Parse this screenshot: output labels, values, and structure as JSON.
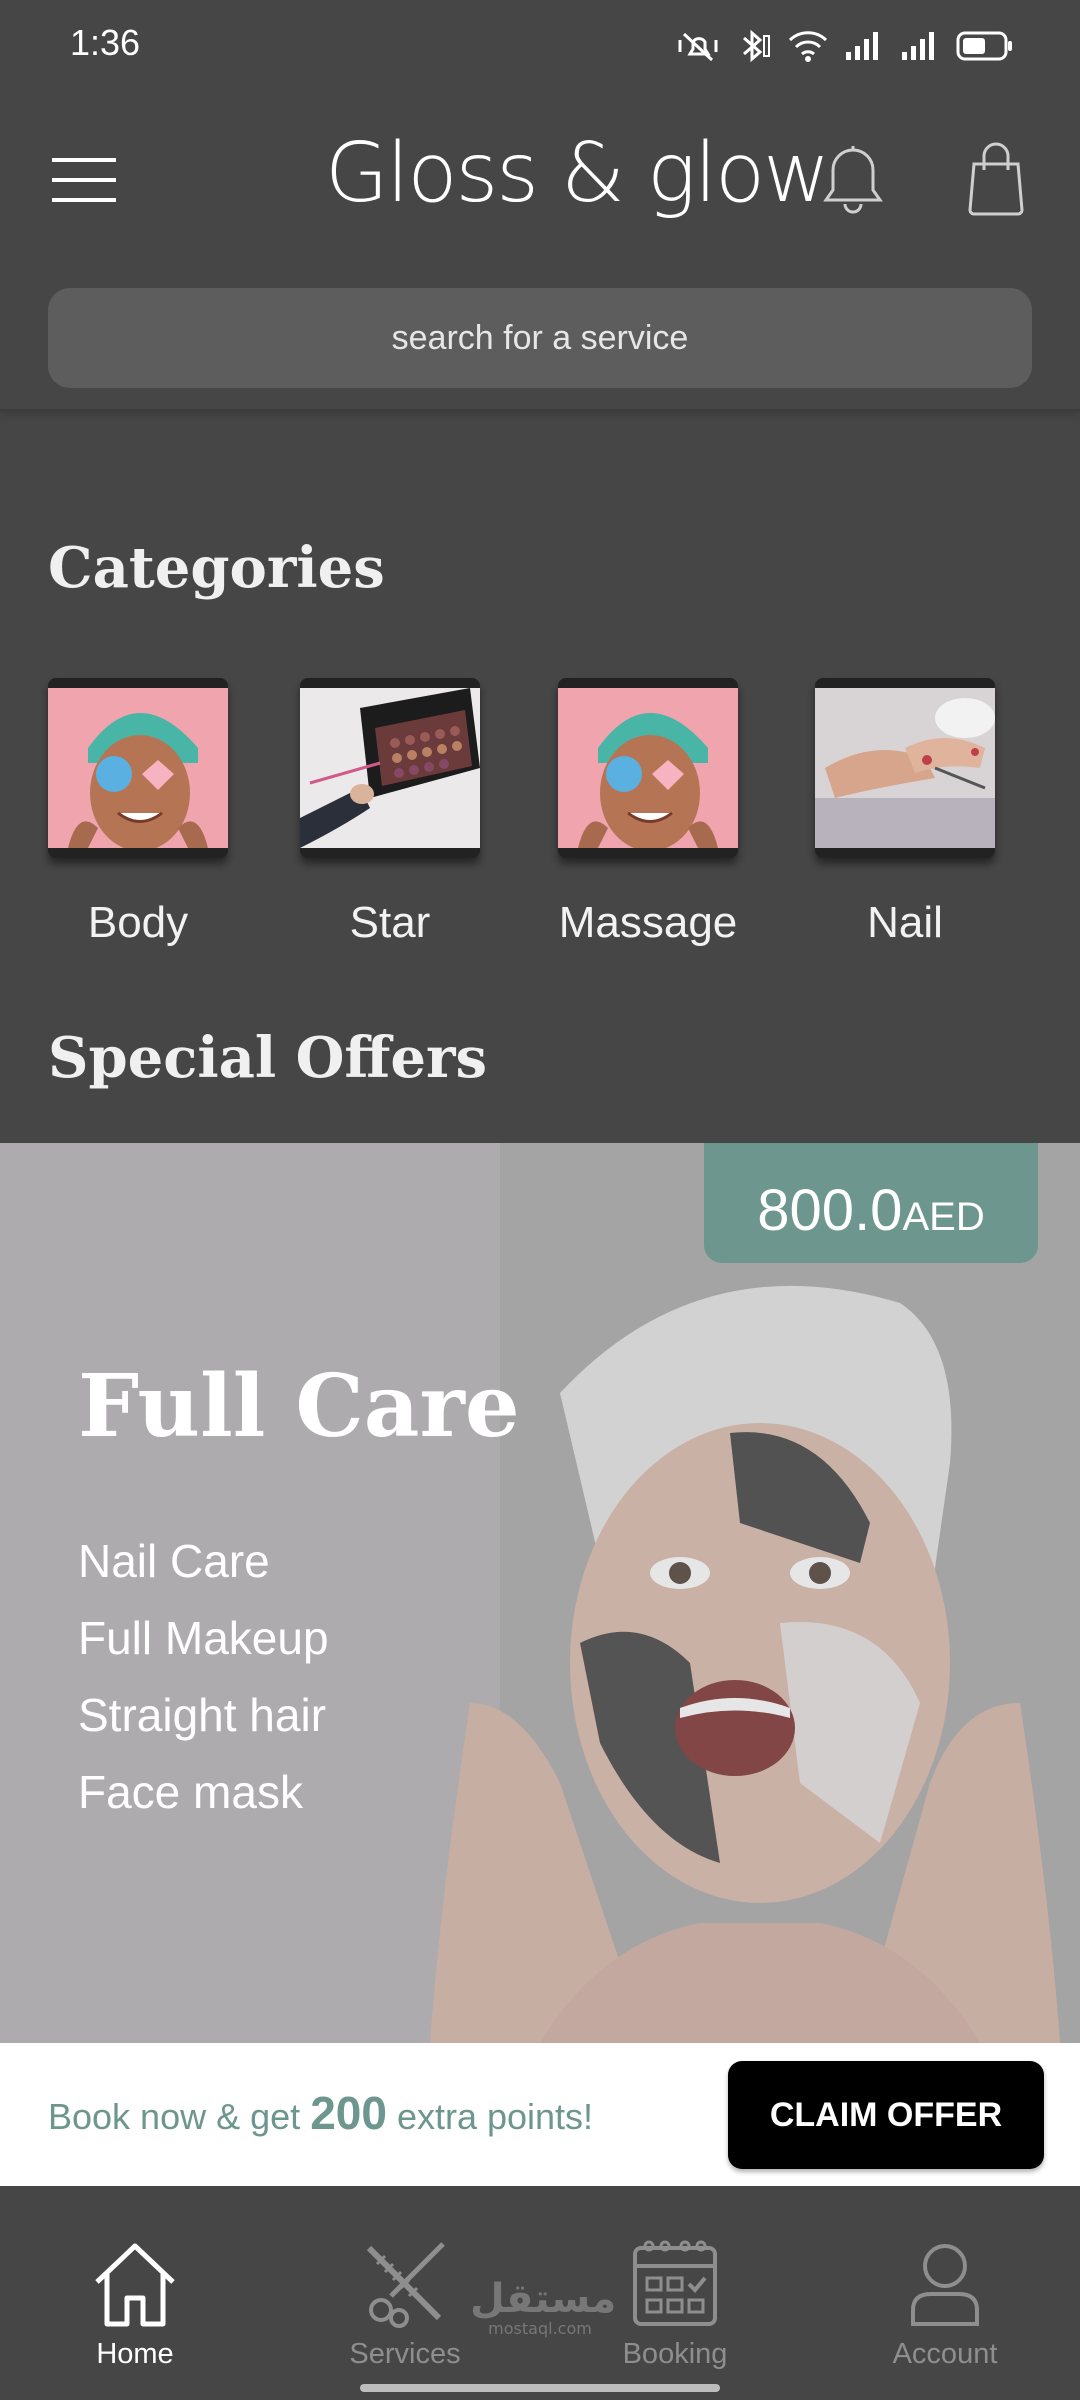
{
  "status_bar": {
    "time": "1:36",
    "icons": [
      "vibrate-icon",
      "bluetooth-icon",
      "wifi-icon",
      "signal-icon",
      "signal-icon",
      "battery-icon"
    ]
  },
  "header": {
    "brand": "Gloss & glow",
    "icons": [
      "menu-icon",
      "bell-icon",
      "shopping-bag-icon"
    ]
  },
  "search": {
    "placeholder": "search for a service"
  },
  "categories": {
    "title": "Categories",
    "items": [
      {
        "label": "Body",
        "icon": "face-mask-photo"
      },
      {
        "label": "Star",
        "icon": "makeup-palette-photo"
      },
      {
        "label": "Massage",
        "icon": "face-mask-photo"
      },
      {
        "label": "Nail",
        "icon": "manicure-photo"
      }
    ]
  },
  "offers": {
    "title": "Special Offers",
    "banner": {
      "price": "800.0",
      "currency": "AED",
      "title": "Full Care",
      "items": [
        "Nail Care",
        "Full Makeup",
        "Straight hair",
        "Face mask"
      ]
    },
    "claim": {
      "text_before": "Book now & get",
      "points": "200",
      "text_after": "extra points!",
      "button": "CLAIM OFFER"
    }
  },
  "bottom_nav": {
    "items": [
      {
        "label": "Home",
        "icon": "home-icon",
        "active": true
      },
      {
        "label": "Services",
        "icon": "scissors-comb-icon",
        "active": false
      },
      {
        "label": "Booking",
        "icon": "calendar-icon",
        "active": false
      },
      {
        "label": "Account",
        "icon": "user-icon",
        "active": false
      }
    ],
    "watermark": {
      "main": "مستقل",
      "sub": "mostaql.com"
    }
  },
  "colors": {
    "background": "#464646",
    "accent": "#6d968e",
    "search": "#5d5d5d",
    "button": "#000000"
  }
}
